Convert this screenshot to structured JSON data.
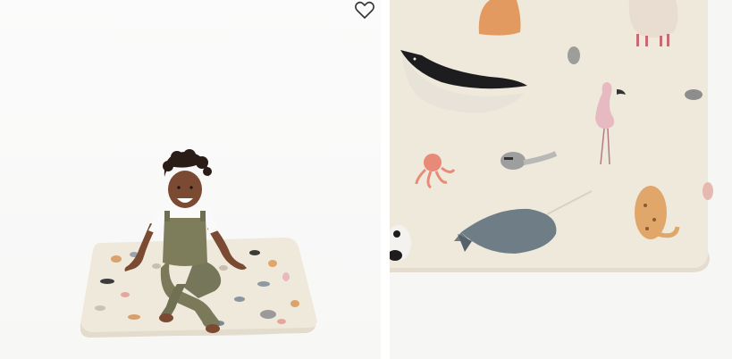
{
  "product_gallery": {
    "favorite": {
      "label": "",
      "icon": "heart-outline-icon"
    },
    "images": [
      {
        "name": "lifestyle-photo",
        "subject": ""
      },
      {
        "name": "closeup-photo",
        "subject": ""
      }
    ]
  },
  "colors": {
    "background": "#f7f7f6",
    "mat_cream": "#efe9dc",
    "overalls_olive": "#7a7a5a",
    "whale_black": "#1d1d1f",
    "narwhal_gray": "#6f7d86",
    "flamingo_pink": "#e7b9c0",
    "octopus_coral": "#e98a78",
    "leopard_tan": "#e0a66a"
  }
}
